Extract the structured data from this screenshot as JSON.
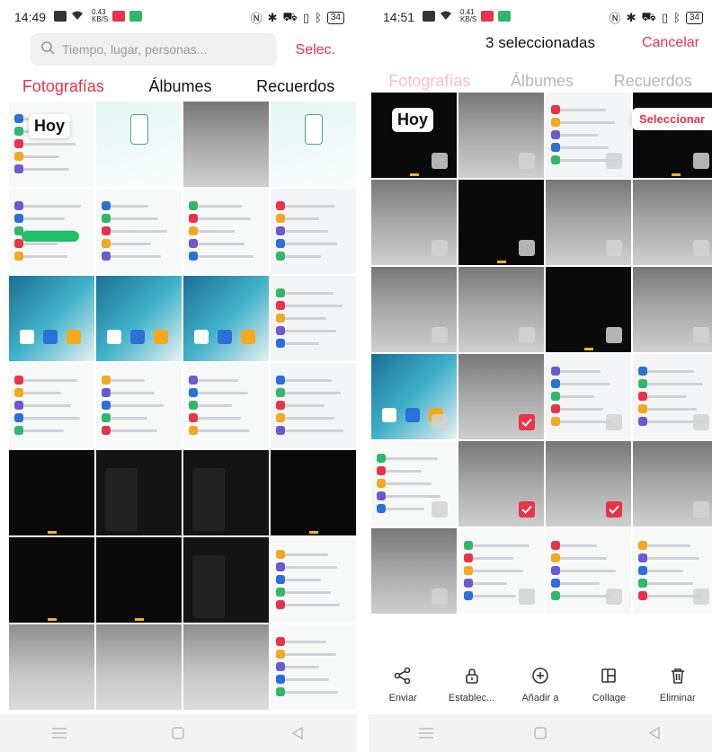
{
  "left": {
    "status": {
      "time": "14:49",
      "netspeed_value": "0.43",
      "netspeed_unit": "KB/S",
      "battery": "34"
    },
    "search": {
      "placeholder": "Tiempo, lugar, personas..."
    },
    "select_label": "Selec.",
    "tabs": [
      "Fotografías",
      "Álbumes",
      "Recuerdos"
    ],
    "date_label": "Hoy",
    "cells": [
      "c-white",
      "c-mint",
      "c-gray",
      "c-mint",
      "c-white",
      "c-white",
      "c-white",
      "c-screen",
      "c-blue",
      "c-blue",
      "c-blue",
      "c-screen",
      "c-white",
      "c-white",
      "c-white",
      "c-screen",
      "c-black",
      "c-dark",
      "c-dark",
      "c-black",
      "c-black",
      "c-black",
      "c-dark",
      "c-white",
      "c-lightgray",
      "c-lightgray",
      "c-lightgray",
      "c-white"
    ]
  },
  "right": {
    "status": {
      "time": "14:51",
      "netspeed_value": "0.41",
      "netspeed_unit": "KB/S",
      "battery": "34"
    },
    "title": "3 seleccionadas",
    "cancel_label": "Cancelar",
    "tabs": [
      "Fotografías",
      "Álbumes",
      "Recuerdos"
    ],
    "date_label": "Hoy",
    "select_label": "Seleccionar",
    "cells": [
      "c-black",
      "c-gray",
      "c-screen",
      "c-black",
      "c-gray",
      "c-black",
      "c-gray",
      "c-gray",
      "c-gray",
      "c-gray",
      "c-black",
      "c-gray",
      "c-blue",
      "c-gray",
      "c-screen",
      "c-screen",
      "c-white",
      "c-gray",
      "c-gray",
      "c-gray",
      "c-gray",
      "c-white",
      "c-white",
      "c-white"
    ],
    "checked_indices": [
      13,
      17,
      18
    ],
    "actions": [
      {
        "label": "Enviar",
        "icon": "share-icon"
      },
      {
        "label": "Establec...",
        "icon": "lock-icon"
      },
      {
        "label": "Añadir a",
        "icon": "add-circle-icon"
      },
      {
        "label": "Collage",
        "icon": "collage-icon"
      },
      {
        "label": "Eliminar",
        "icon": "trash-icon"
      }
    ]
  },
  "colors": {
    "accent": "#e8334a",
    "check": "#e8334a"
  }
}
